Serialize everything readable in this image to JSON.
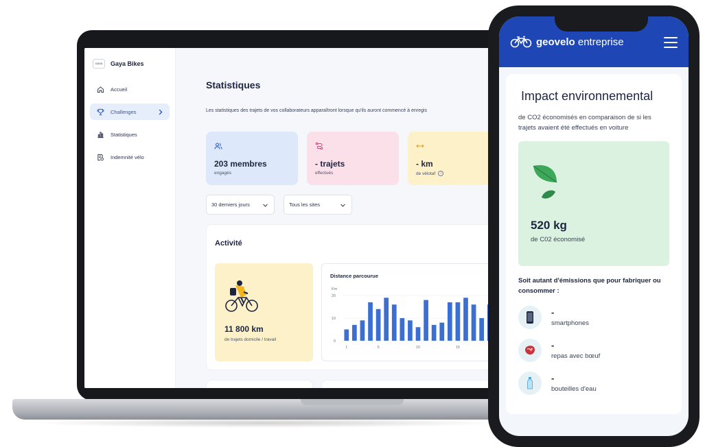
{
  "laptop": {
    "sidebar": {
      "brand_logo": "GAYA",
      "brand_name": "Gaya Bikes",
      "items": [
        {
          "label": "Accueil",
          "icon": "home-icon"
        },
        {
          "label": "Challenges",
          "icon": "trophy-icon",
          "active": true
        },
        {
          "label": "Statistiques",
          "icon": "bar-chart-icon"
        },
        {
          "label": "Indemnité vélo",
          "icon": "document-coin-icon"
        }
      ]
    },
    "main": {
      "title": "Statistiques",
      "description": "Les statistiques des trajets de vos collaborateurs apparaîtront lorsque qu'ils auront commencé à enregis",
      "cards": [
        {
          "value": "203 membres",
          "label": "engagés",
          "icon": "users-icon",
          "color": "#dde9fb"
        },
        {
          "value": "- trajets",
          "label": "effectués",
          "icon": "route-icon",
          "color": "#fbe0ea"
        },
        {
          "value": "- km",
          "label": "de vélotaf",
          "icon": "arrows-horizontal-icon",
          "color": "#fdf1c9"
        }
      ],
      "filters": {
        "period": "30 derniers jours",
        "sites": "Tous les sites"
      },
      "activity": {
        "title": "Activité",
        "km_value": "11 800 km",
        "km_label": "de trajets domicile / travail"
      }
    }
  },
  "chart_data": {
    "type": "bar",
    "title": "Distance parcourue",
    "ylabel": "Km",
    "ylim": [
      0,
      20
    ],
    "yticks": [
      0,
      10,
      20
    ],
    "xticks": [
      1,
      5,
      10,
      15
    ],
    "x": [
      1,
      2,
      3,
      4,
      5,
      6,
      7,
      8,
      9,
      10,
      11,
      12,
      13,
      14,
      15,
      16,
      17,
      18,
      19
    ],
    "values": [
      5,
      7,
      9,
      17,
      14,
      19,
      16,
      10,
      9,
      6,
      18,
      7,
      8,
      17,
      17,
      19,
      16,
      10,
      16
    ],
    "bar_color": "#3b6fd4",
    "grid": true
  },
  "phone": {
    "app_name_bold": "geovelo",
    "app_name_rest": " entreprise",
    "impact_title": "Impact environnemental",
    "impact_desc": "de CO2 économisés en comparaison de si les trajets avaient été effectués en voiture",
    "co2_value": "520 kg",
    "co2_label": "de C02 économisé",
    "equiv_title": "Soit autant d'émissions que pour fabriquer ou consommer :",
    "equivalents": [
      {
        "value": "-",
        "label": "smartphones",
        "icon": "smartphone-icon"
      },
      {
        "value": "-",
        "label": "repas avec bœuf",
        "icon": "steak-icon"
      },
      {
        "value": "-",
        "label": "bouteilles d'eau",
        "icon": "water-bottle-icon"
      }
    ],
    "brand_color": "#1e47b5"
  }
}
